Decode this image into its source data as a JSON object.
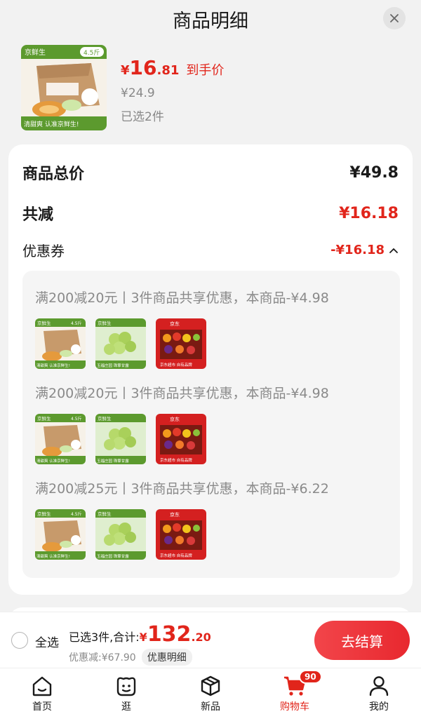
{
  "header": {
    "title": "商品明细"
  },
  "product": {
    "price_symbol": "¥",
    "price_int": "16",
    "price_dec": ".81",
    "price_tag": "到手价",
    "original_price": "¥24.9",
    "selected_count": "已选2件",
    "thumb_badge": "4.5斤",
    "thumb_brand": "京鲜生",
    "thumb_slogan": "清甜爽 认准京鲜生!"
  },
  "summary": {
    "total_label": "商品总价",
    "total_value": "¥49.8",
    "reduce_label": "共减",
    "reduce_value": "¥16.18",
    "coupon_label": "优惠券",
    "coupon_value": "-¥16.18"
  },
  "coupons": [
    {
      "text": "满200减20元丨3件商品共享优惠，本商品-¥4.98"
    },
    {
      "text": "满200减20元丨3件商品共享优惠，本商品-¥4.98"
    },
    {
      "text": "满200减25元丨3件商品共享优惠，本商品-¥6.22"
    }
  ],
  "coupon_thumbs": {
    "melon_badge": "4.5斤",
    "melon_brand": "京鲜生",
    "melon_slogan": "清甜爽 认准京鲜生!",
    "grape_brand": "京鲜生",
    "grape_caption": "玉福庄园 珠擎甘露",
    "gift_brand": "京东",
    "gift_caption": "京东超市 自有品牌"
  },
  "checkout": {
    "select_all": "全选",
    "summary_text": "已选3件,合计:",
    "total_symbol": "¥",
    "total_int": "132",
    "total_dec": ".20",
    "discount_text": "优惠减:¥67.90",
    "detail_chip": "优惠明细",
    "button": "去结算"
  },
  "tabs": [
    {
      "label": "首页",
      "icon": "home-icon"
    },
    {
      "label": "逛",
      "icon": "explore-icon"
    },
    {
      "label": "新品",
      "icon": "new-product-icon"
    },
    {
      "label": "购物车",
      "icon": "cart-icon",
      "badge": "90",
      "active": true
    },
    {
      "label": "我的",
      "icon": "profile-icon"
    }
  ],
  "colors": {
    "accent": "#e1251b",
    "button": "#ec2f35"
  }
}
